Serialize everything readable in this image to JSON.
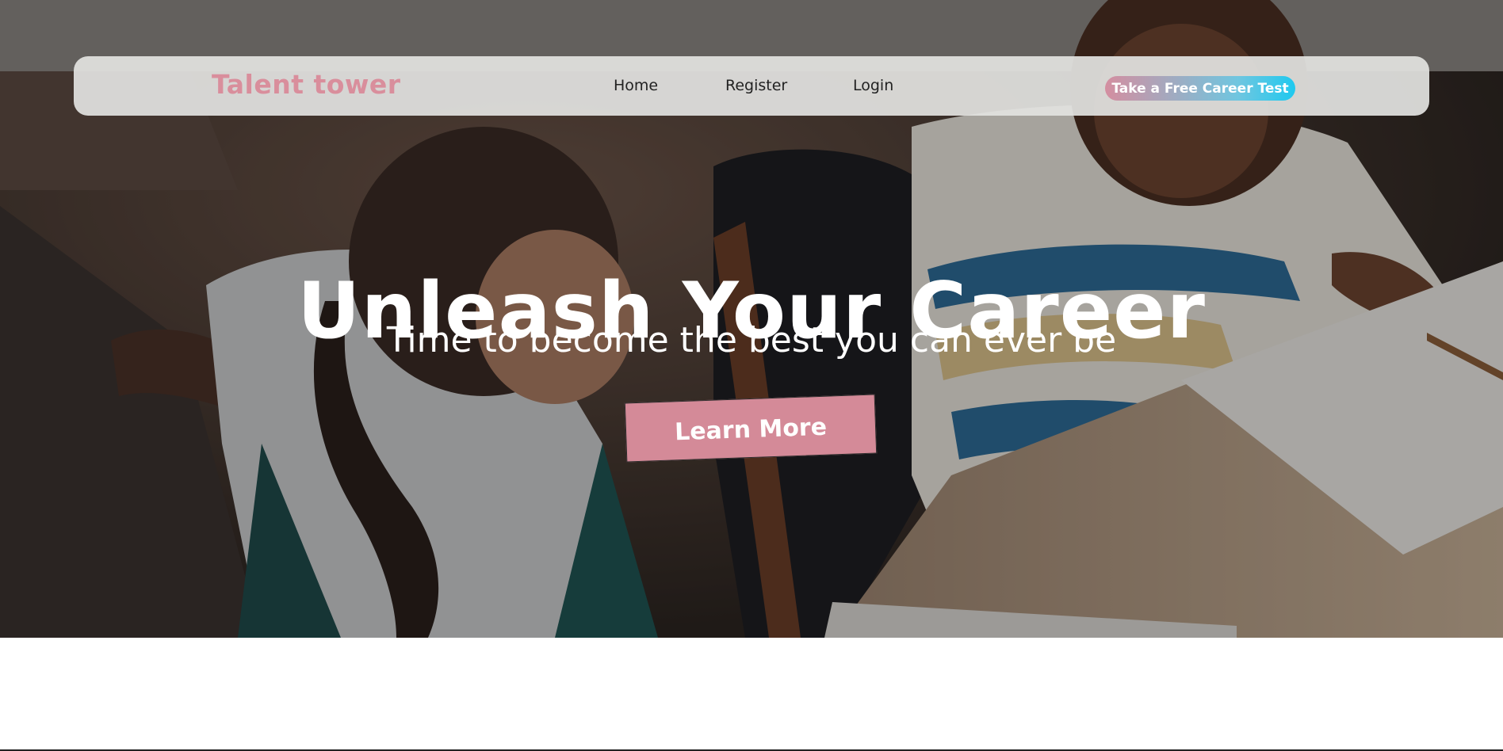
{
  "navbar": {
    "brand": "Talent tower",
    "links": [
      {
        "label": "Home"
      },
      {
        "label": "Register"
      },
      {
        "label": "Login"
      }
    ],
    "cta_label": "Take a Free Career Test"
  },
  "hero": {
    "headline": "Unleash Your Career",
    "subline": "Time to become the best you can ever be",
    "button_label": "Learn More",
    "photo_icon": "classroom-photo"
  },
  "colors": {
    "brand": "#d98e9c",
    "button": "#d48a98",
    "cta_gradient_start": "#d48ea0",
    "cta_gradient_end": "#1fc9ef",
    "navbar_bg": "#e2e2e0"
  }
}
